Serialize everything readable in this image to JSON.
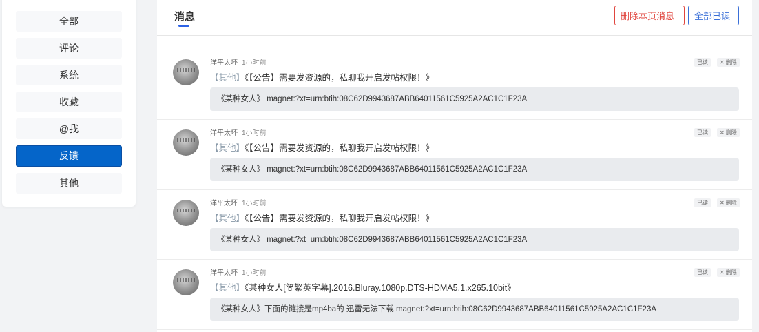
{
  "sidebar": {
    "items": [
      {
        "label": "全部"
      },
      {
        "label": "评论"
      },
      {
        "label": "系统"
      },
      {
        "label": "收藏"
      },
      {
        "label": "@我"
      },
      {
        "label": "反馈",
        "active": true
      },
      {
        "label": "其他"
      }
    ]
  },
  "header": {
    "tab_label": "消息",
    "delete_page_button": "删除本页消息",
    "mark_all_read_button": "全部已读"
  },
  "messages": [
    {
      "user": "洋平太坏",
      "time": "1小时前",
      "category": "【其他】",
      "subject": "《【公告】需要发资源的，私聊我开启发帖权限！》",
      "content": "《某种女人》 magnet:?xt=urn:btih:08C62D9943687ABB64011561C5925A2AC1C1F23A",
      "read_label": "已读",
      "delete_label": "删除"
    },
    {
      "user": "洋平太坏",
      "time": "1小时前",
      "category": "【其他】",
      "subject": "《【公告】需要发资源的，私聊我开启发帖权限！》",
      "content": "《某种女人》 magnet:?xt=urn:btih:08C62D9943687ABB64011561C5925A2AC1C1F23A",
      "read_label": "已读",
      "delete_label": "删除"
    },
    {
      "user": "洋平太坏",
      "time": "1小时前",
      "category": "【其他】",
      "subject": "《【公告】需要发资源的，私聊我开启发帖权限！》",
      "content": "《某种女人》 magnet:?xt=urn:btih:08C62D9943687ABB64011561C5925A2AC1C1F23A",
      "read_label": "已读",
      "delete_label": "删除"
    },
    {
      "user": "洋平太坏",
      "time": "1小时前",
      "category": "【其他】",
      "subject": "《某种女人[简繁英字幕].2016.Bluray.1080p.DTS-HDMA5.1.x265.10bit》",
      "content": "《某种女人》下面的链接是mp4ba的 迅雷无法下载 magnet:?xt=urn:btih:08C62D9943687ABB64011561C5925A2AC1C1F23A",
      "read_label": "已读",
      "delete_label": "删除"
    }
  ]
}
